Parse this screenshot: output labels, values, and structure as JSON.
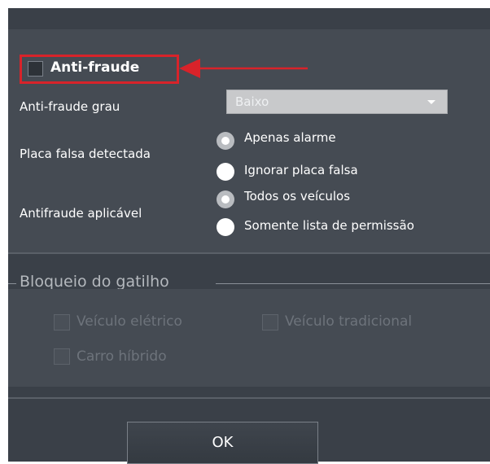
{
  "antifraud": {
    "label": "Anti-fraude",
    "checked": false
  },
  "form": {
    "grade_label": "Anti-fraude grau",
    "grade_value": "Baixo",
    "fake_plate_label": "Placa falsa detectada",
    "fake_plate_options": [
      "Apenas alarme",
      "Ignorar placa falsa"
    ],
    "fake_plate_selected": "Apenas alarme",
    "applicable_label": "Antifraude aplicável",
    "applicable_options": [
      "Todos os veículos",
      "Somente lista de permissão"
    ],
    "applicable_selected": "Todos os veículos"
  },
  "trigger_lock": {
    "title": "Bloqueio do gatilho",
    "options": [
      "Veículo elétrico",
      "Veículo tradicional",
      "Carro híbrido"
    ]
  },
  "ok_button": "OK",
  "colors": {
    "highlight": "#d8232a",
    "panel": "#3a4048",
    "section": "#454b53"
  }
}
